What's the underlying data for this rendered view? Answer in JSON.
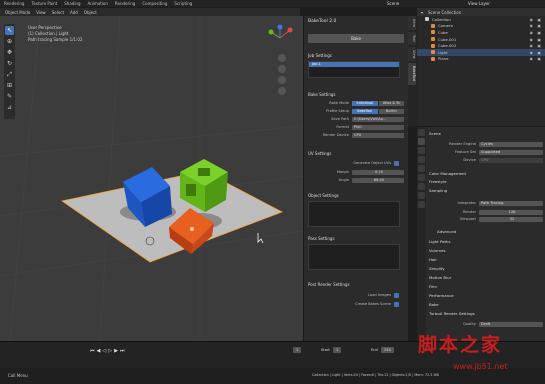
{
  "topbar": {
    "menus": [
      "Rendering",
      "Texture Paint",
      "Shading",
      "Animation",
      "Rendering",
      "Compositing",
      "Scripting"
    ],
    "scene": "Scene",
    "view_layer": "View Layer"
  },
  "viewport": {
    "header": [
      "Object Mode",
      "View",
      "Select",
      "Add",
      "Object"
    ],
    "info": [
      "User Perspective",
      "(1) Collection | Light",
      "Path tracing Sample 1/1:02"
    ]
  },
  "bake_panel": {
    "title": "BakeTool 2.0",
    "bake_button": "Bake",
    "job_settings": "Job Settings",
    "job_name": "Job.1",
    "bake_settings": "Bake Settings",
    "bake_mode_label": "Bake Mode",
    "bake_mode_options": [
      "Individual",
      "Atlas & Ta"
    ],
    "profile_label": "Profile Setup",
    "profile_options": [
      "BakeTool",
      "Builtin"
    ],
    "save_path_label": "Save Path",
    "save_path": "C:\\Users\\Vict\\Ap...",
    "format_label": "Format",
    "format": "PNG",
    "render_device_label": "Render Device",
    "render_device": "CPU",
    "uv_settings": "UV Settings",
    "generate_uv_label": "Generate Object UVs",
    "margin_label": "Margin",
    "margin": "0.10",
    "angle_label": "Angle",
    "angle": "66.00",
    "object_settings": "Object Settings",
    "pass_settings": "Pass Settings",
    "post_render": "Post Render Settings",
    "load_images": "Load Images",
    "create_bake_scene": "Create Bakes Scene"
  },
  "side_tabs": [
    "Item",
    "Tool",
    "View",
    "BakeTool"
  ],
  "outliner": {
    "title": "Scene Collection",
    "items": [
      {
        "name": "Collection",
        "color": "#d0d0d0"
      },
      {
        "name": "Camera",
        "color": "#e08a3a"
      },
      {
        "name": "Cube",
        "color": "#e08a3a"
      },
      {
        "name": "Cube.001",
        "color": "#e08a3a"
      },
      {
        "name": "Cube.002",
        "color": "#e08a3a"
      },
      {
        "name": "Light",
        "color": "#e08a3a"
      },
      {
        "name": "Plane",
        "color": "#e08a3a"
      }
    ]
  },
  "properties": {
    "scene_label": "Scene",
    "render_engine_label": "Render Engine",
    "render_engine": "Cycles",
    "feature_set_label": "Feature Set",
    "feature_set": "Supported",
    "device_label": "Device",
    "device": "CPU",
    "sections": [
      "Color Management",
      "Freestyle",
      "Sampling"
    ],
    "integrator_label": "Integrator",
    "integrator": "Path Tracing",
    "render_label": "Render",
    "render_samples": "128",
    "viewport_label": "Viewport",
    "viewport_samples": "32",
    "advanced": "Advanced",
    "more_sections": [
      "Light Paths",
      "Volumes",
      "Hair",
      "Simplify",
      "Motion Blur",
      "Film",
      "Performance",
      "Bake",
      "TurboX Render Settings"
    ],
    "quality_label": "Quality",
    "quality": "Draft"
  },
  "timeline": {
    "current_frame": "1",
    "start_label": "Start",
    "start": "1",
    "end_label": "End",
    "end": "250"
  },
  "status": {
    "left": "Call Menu",
    "right": "Collection | Light | Verts:24 | Faces:6 | Tris:12 | Objects:1/5 | Mem: 72.3 MB"
  },
  "watermark": {
    "text": "脚本之家",
    "url": "www.jb51.net"
  },
  "colors": {
    "accent": "#4772b3",
    "blue_cube": "#1f5fd1",
    "green_cube": "#6bc21f",
    "orange_cube": "#e0511a",
    "selection": "#f0a030"
  }
}
